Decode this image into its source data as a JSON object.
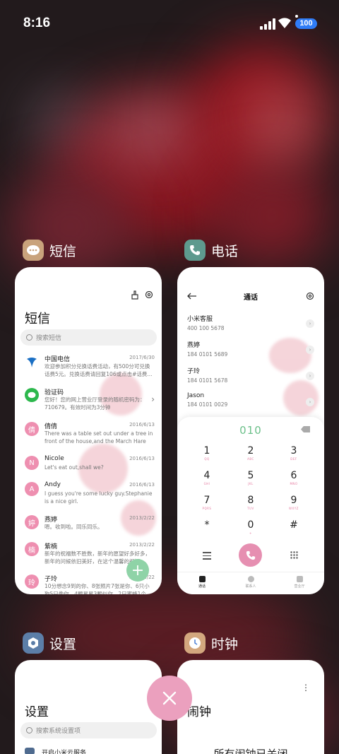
{
  "status_bar": {
    "time": "8:16",
    "battery": "100"
  },
  "apps": {
    "sms": {
      "name": "短信",
      "title": "短信",
      "search_placeholder": "搜索短信",
      "messages": [
        {
          "avatar": "",
          "name": "中国电信",
          "date": "2017/6/30",
          "text": "欢迎参加积分兑换话费活动，有500分可兑换话费5元。兑换话费请回复106或点击#话费..."
        },
        {
          "avatar": "",
          "name": "验证码",
          "date": "",
          "text": "您好！您的网上营业厅登录的随机密码为：710679。有效时间为3分钟"
        },
        {
          "avatar": "倩",
          "name": "倩倩",
          "date": "2016/6/13",
          "text": "There was a table set out under a tree in front of the house,and the March Hare an..."
        },
        {
          "avatar": "N",
          "name": "Nicole",
          "date": "2016/6/13",
          "text": "Let's eat out,shall we?"
        },
        {
          "avatar": "A",
          "name": "Andy",
          "date": "2016/6/13",
          "text": "I guess you're some lucky guy.Stephanie is a nice girl."
        },
        {
          "avatar": "婷",
          "name": "燕婷",
          "date": "2013/2/22",
          "text": "嗯。收到啦。同乐同乐。"
        },
        {
          "avatar": "楠",
          "name": "紫楠",
          "date": "2013/2/22",
          "text": "新年的祝福数不胜数，新年的愿望好多好多，新年的问候依旧美好，在这个温馨的祝福..."
        },
        {
          "avatar": "玲",
          "name": "子玲",
          "date": "2013/2/22",
          "text": "10分想念9到的你、8张照片7张是你、6只小狗5只像你、4颗星星3颗似你、2只蜜蜂1个..."
        }
      ]
    },
    "phone": {
      "name": "电话",
      "title": "通话",
      "calls": [
        {
          "name": "小米客服",
          "number": "400 100 5678"
        },
        {
          "name": "燕婷",
          "number": "184 0101 5689"
        },
        {
          "name": "子玲",
          "number": "184 0101 5678"
        },
        {
          "name": "Jason",
          "number": "184 0101 0029"
        }
      ],
      "dialed": "010",
      "keys": [
        {
          "d": "1",
          "l": "QQ"
        },
        {
          "d": "2",
          "l": "ABC"
        },
        {
          "d": "3",
          "l": "DEF"
        },
        {
          "d": "4",
          "l": "GHI"
        },
        {
          "d": "5",
          "l": "JKL"
        },
        {
          "d": "6",
          "l": "MNO"
        },
        {
          "d": "7",
          "l": "PQRS"
        },
        {
          "d": "8",
          "l": "TUV"
        },
        {
          "d": "9",
          "l": "WXYZ"
        },
        {
          "d": "*",
          "l": ""
        },
        {
          "d": "0",
          "l": "+"
        },
        {
          "d": "#",
          "l": ""
        }
      ],
      "tabs": [
        "通话",
        "联系人",
        "营业厅"
      ]
    },
    "settings": {
      "name": "设置",
      "title": "设置",
      "search_placeholder": "搜索系统设置项",
      "first_item": "开启小米云服务"
    },
    "clock": {
      "name": "时钟",
      "title": "闹钟",
      "status": "所有闹钟已关闭"
    }
  },
  "colors": {
    "accent_green": "#6cc08a",
    "pink": "#e68fb1",
    "close_button": "#eba0be"
  }
}
